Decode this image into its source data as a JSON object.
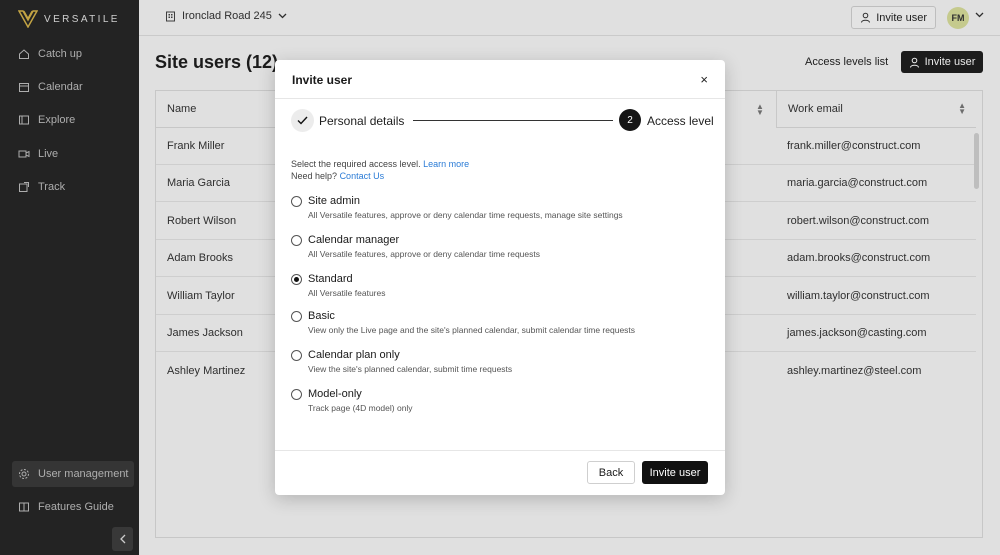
{
  "app": {
    "brand": "VERSATILE"
  },
  "sidebar": {
    "items": [
      {
        "label": "Catch up",
        "icon": "home-icon"
      },
      {
        "label": "Calendar",
        "icon": "calendar-icon"
      },
      {
        "label": "Explore",
        "icon": "explore-icon"
      },
      {
        "label": "Live",
        "icon": "video-icon"
      },
      {
        "label": "Track",
        "icon": "track-icon"
      }
    ],
    "bottom_items": [
      {
        "label": "User management",
        "icon": "gear-icon",
        "active": true
      },
      {
        "label": "Features Guide",
        "icon": "book-icon"
      }
    ]
  },
  "topbar": {
    "site": "Ironclad Road 245",
    "invite_label": "Invite user",
    "avatar_initials": "FM"
  },
  "page": {
    "title": "Site users (12)",
    "access_levels_link": "Access levels list",
    "invite_button": "Invite user"
  },
  "table": {
    "columns": [
      "Name",
      "Work email"
    ],
    "rows": [
      {
        "name": "Frank Miller",
        "email": "frank.miller@construct.com"
      },
      {
        "name": "Maria Garcia",
        "email": "maria.garcia@construct.com"
      },
      {
        "name": "Robert Wilson",
        "email": "robert.wilson@construct.com"
      },
      {
        "name": "Adam Brooks",
        "email": "adam.brooks@construct.com"
      },
      {
        "name": "William Taylor",
        "email": "william.taylor@construct.com"
      },
      {
        "name": "James Jackson",
        "email": "james.jackson@casting.com"
      },
      {
        "name": "Ashley Martinez",
        "email": "ashley.martinez@steel.com"
      }
    ]
  },
  "modal": {
    "title": "Invite user",
    "close": "×",
    "steps": [
      {
        "label": "Personal details",
        "done": true
      },
      {
        "number": "2",
        "label": "Access level",
        "active": true
      }
    ],
    "intro_text": "Select the required access level.",
    "learn_more": "Learn more",
    "help_text": "Need help?",
    "contact_us": "Contact Us",
    "options": [
      {
        "label": "Site admin",
        "desc": "All Versatile features, approve or deny calendar time requests, manage site settings",
        "checked": false
      },
      {
        "label": "Calendar manager",
        "desc": "All Versatile features, approve or deny calendar time requests",
        "checked": false
      },
      {
        "label": "Standard",
        "desc": "All Versatile features",
        "checked": true
      },
      {
        "label": "Basic",
        "desc": "View only the Live page and the site's planned calendar, submit calendar time requests",
        "checked": false
      },
      {
        "label": "Calendar plan only",
        "desc": "View the site's planned calendar, submit time requests",
        "checked": false
      },
      {
        "label": "Model-only",
        "desc": "Track page (4D model) only",
        "checked": false
      }
    ],
    "back_button": "Back",
    "invite_button": "Invite user"
  }
}
